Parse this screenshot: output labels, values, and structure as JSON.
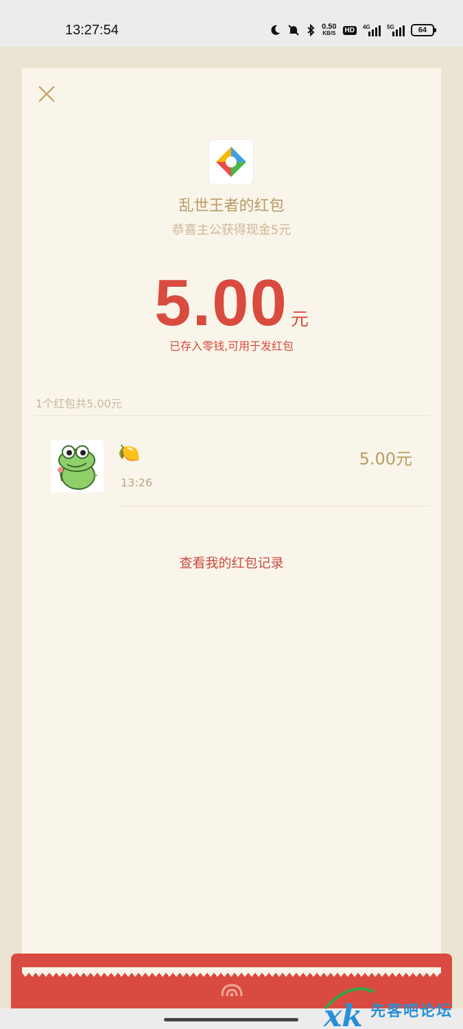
{
  "status_bar": {
    "time": "13:27:54",
    "net_speed": "0.50",
    "net_unit": "KB/S",
    "hd_label": "HD",
    "signal1": "4G",
    "signal2": "5G",
    "battery": "64"
  },
  "redpacket": {
    "sender": "乱世王者的红包",
    "wish": "恭喜主公获得现金5元",
    "amount": "5.00",
    "currency": "元",
    "saved_note": "已存入零钱,可用于发红包",
    "summary": "1个红包共5.00元",
    "records_link": "查看我的红包记录"
  },
  "records": [
    {
      "emoji": "🍋",
      "time": "13:26",
      "amount": "5.00元"
    }
  ],
  "watermark": {
    "text": "先客吧论坛"
  },
  "colors": {
    "accent_red": "#d94b3e",
    "gold": "#b89a64",
    "card_bg": "#faf5ea"
  }
}
